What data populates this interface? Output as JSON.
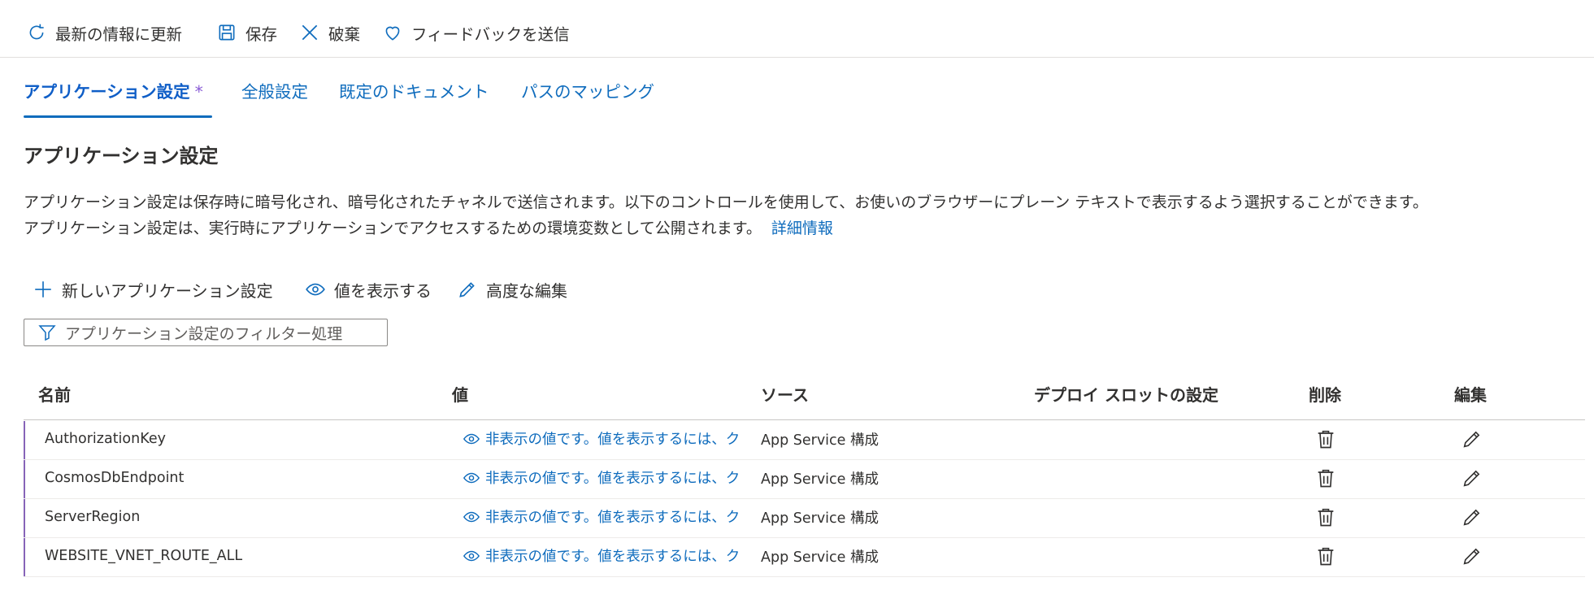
{
  "toolbar": {
    "refresh_label": "最新の情報に更新",
    "save_label": "保存",
    "discard_label": "破棄",
    "feedback_label": "フィードバックを送信"
  },
  "tabs": [
    {
      "label": "アプリケーション設定",
      "active": true,
      "modified_mark": "*"
    },
    {
      "label": "全般設定"
    },
    {
      "label": "既定のドキュメント"
    },
    {
      "label": "パスのマッピング"
    }
  ],
  "section": {
    "title": "アプリケーション設定",
    "desc_line1": "アプリケーション設定は保存時に暗号化され、暗号化されたチャネルで送信されます。以下のコントロールを使用して、お使いのブラウザーにプレーン テキストで表示するよう選択することができます。",
    "desc_line2": "アプリケーション設定は、実行時にアプリケーションでアクセスするための環境変数として公開されます。",
    "learn_more": "詳細情報"
  },
  "actions": {
    "new_setting": "新しいアプリケーション設定",
    "show_values": "値を表示する",
    "advanced_edit": "高度な編集"
  },
  "filter": {
    "placeholder": "アプリケーション設定のフィルター処理"
  },
  "table": {
    "headers": {
      "name": "名前",
      "value": "値",
      "source": "ソース",
      "slot": "デプロイ スロットの設定",
      "delete": "削除",
      "edit": "編集"
    },
    "rows": [
      {
        "name": "AuthorizationKey",
        "value": "非表示の値です。値を表示するには、ク",
        "source": "App Service 構成"
      },
      {
        "name": "CosmosDbEndpoint",
        "value": "非表示の値です。値を表示するには、ク",
        "source": "App Service 構成"
      },
      {
        "name": "ServerRegion",
        "value": "非表示の値です。値を表示するには、ク",
        "source": "App Service 構成"
      },
      {
        "name": "WEBSITE_VNET_ROUTE_ALL",
        "value": "非表示の値です。値を表示するには、ク",
        "source": "App Service 構成"
      }
    ]
  },
  "colors": {
    "accent": "#0f6cbd",
    "modified_bar": "#8764b8"
  },
  "icons": [
    "refresh-icon",
    "save-icon",
    "close-icon",
    "heart-icon",
    "add-icon",
    "eye-icon",
    "pencil-icon",
    "filter-icon",
    "trash-icon"
  ]
}
